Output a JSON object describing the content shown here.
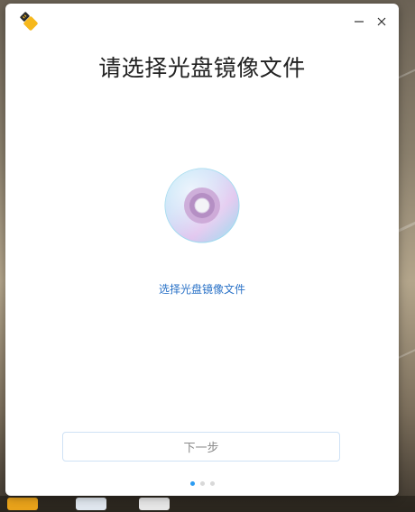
{
  "window": {
    "title": "请选择光盘镜像文件",
    "select_link": "选择光盘镜像文件",
    "next_button": "下一步",
    "pager": {
      "total": 3,
      "active": 0
    },
    "icons": {
      "app": "usb-drive-icon",
      "minimize": "minimize-icon",
      "close": "close-icon",
      "disc": "disc-icon"
    },
    "colors": {
      "accent": "#2c9cf2",
      "link": "#2a72c7",
      "button_border": "#cfe2f5"
    }
  }
}
